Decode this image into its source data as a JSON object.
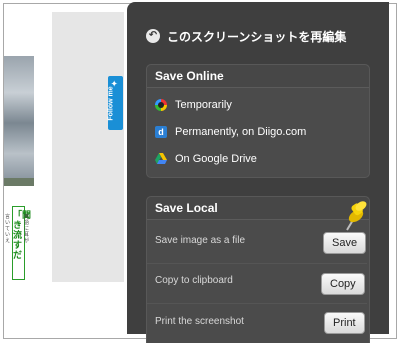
{
  "header": {
    "title": "このスクリーンショットを再編集"
  },
  "left_page": {
    "follow_label": "Follow me",
    "jp_big": "「聞き流すだ",
    "jp_small_left": "言いていえ",
    "jp_small_right": "英語に耳が"
  },
  "save_online": {
    "title": "Save Online",
    "items": [
      {
        "label": "Temporarily",
        "icon": "temporary-icon"
      },
      {
        "label": "Permanently, on Diigo.com",
        "icon": "diigo-icon"
      },
      {
        "label": "On Google Drive",
        "icon": "google-drive-icon"
      }
    ]
  },
  "save_local": {
    "title": "Save Local",
    "items": [
      {
        "label": "Save image as a file",
        "button": "Save"
      },
      {
        "label": "Copy to clipboard",
        "button": "Copy"
      },
      {
        "label": "Print the screenshot",
        "button": "Print"
      }
    ]
  },
  "colors": {
    "panel": "#3f3f3f",
    "card": "#4b4b4b",
    "pin": "#f5d000",
    "diigo": "#2b7fd3"
  }
}
